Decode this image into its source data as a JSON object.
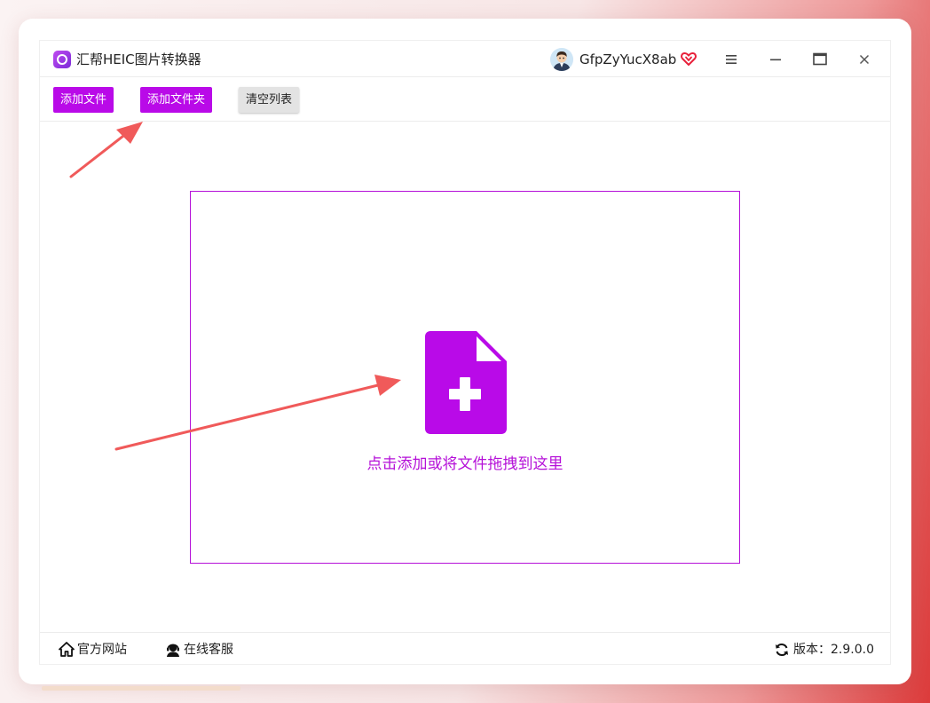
{
  "app": {
    "title": "汇帮HEIC图片转换器",
    "username": "GfpZyYucX8ab"
  },
  "window_controls": {
    "menu_icon": "hamburger-menu-icon",
    "minimize_icon": "minimize-icon",
    "maximize_icon": "maximize-icon",
    "close_icon": "close-icon"
  },
  "toolbar": {
    "add_file_label": "添加文件",
    "add_folder_label": "添加文件夹",
    "clear_list_label": "清空列表"
  },
  "dropzone": {
    "hint": "点击添加或将文件拖拽到这里",
    "icon": "file-add-icon"
  },
  "footer": {
    "website_label": "官方网站",
    "support_label": "在线客服",
    "version_label": "版本：",
    "version_value": "2.9.0.0"
  },
  "colors": {
    "accent": "#b90ae8",
    "drop_text": "#b510d8",
    "annotation_arrow": "#f05a5a",
    "vip_heart": "#e8203a"
  }
}
